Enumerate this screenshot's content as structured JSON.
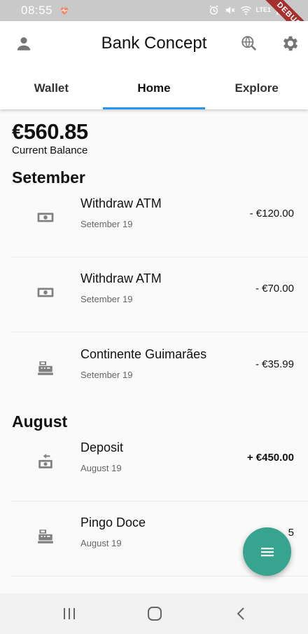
{
  "status_bar": {
    "time": "08:55",
    "network": "LTE1",
    "debug_label": "DEBUG"
  },
  "app_bar": {
    "title": "Bank Concept"
  },
  "tabs": [
    {
      "label": "Wallet"
    },
    {
      "label": "Home",
      "active": true
    },
    {
      "label": "Explore"
    }
  ],
  "balance": {
    "amount": "€560.85",
    "label": "Current Balance"
  },
  "groups": [
    {
      "month": "Setember",
      "transactions": [
        {
          "title": "Withdraw ATM",
          "date": "Setember 19",
          "amount": "- €120.00",
          "icon": "cash-icon"
        },
        {
          "title": "Withdraw ATM",
          "date": "Setember 19",
          "amount": "- €70.00",
          "icon": "cash-icon"
        },
        {
          "title": "Continente Guimarães",
          "date": "Setember 19",
          "amount": "- €35.99",
          "icon": "cash-register-icon"
        }
      ]
    },
    {
      "month": "August",
      "transactions": [
        {
          "title": "Deposit",
          "date": "August 19",
          "amount": "+ €450.00",
          "icon": "deposit-icon"
        },
        {
          "title": "Pingo Doce",
          "date": "August 19",
          "amount": "5",
          "icon": "cash-register-icon"
        }
      ]
    }
  ],
  "colors": {
    "accent": "#2196f3",
    "fab": "#36a48e",
    "icon_gray": "#808080"
  }
}
